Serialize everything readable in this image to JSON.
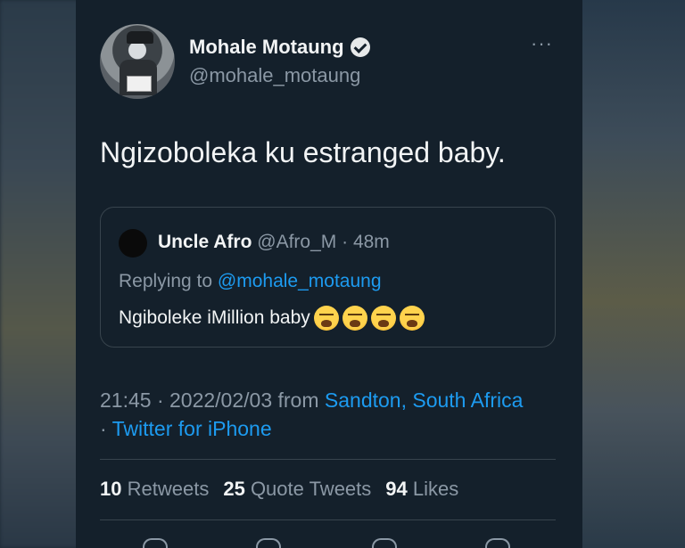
{
  "tweet": {
    "author": {
      "display_name": "Mohale Motaung",
      "handle": "@mohale_motaung",
      "verified": true
    },
    "more_icon": "more-horizontal-icon",
    "text": "Ngizoboleka ku estranged baby.",
    "quoted": {
      "author_name": "Uncle Afro",
      "author_handle": "@Afro_M",
      "separator": "·",
      "time": "48m",
      "replying_label": "Replying to",
      "replying_to": "@mohale_motaung",
      "text": "Ngiboleke iMillion baby",
      "emojis": [
        "loudly-crying-face",
        "loudly-crying-face",
        "loudly-crying-face",
        "loudly-crying-face"
      ]
    },
    "meta": {
      "timestamp": "21:45 · 2022/02/03 from",
      "location": "Sandton, South Africa",
      "separator": "·",
      "source": "Twitter for iPhone"
    },
    "stats": {
      "retweets_count": "10",
      "retweets_label": "Retweets",
      "quotes_count": "25",
      "quotes_label": "Quote Tweets",
      "likes_count": "94",
      "likes_label": "Likes"
    }
  },
  "colors": {
    "background": "#14202b",
    "text": "#e7e9ea",
    "secondary": "#8b98a5",
    "link": "#1d9bf0",
    "border": "#38444d"
  }
}
